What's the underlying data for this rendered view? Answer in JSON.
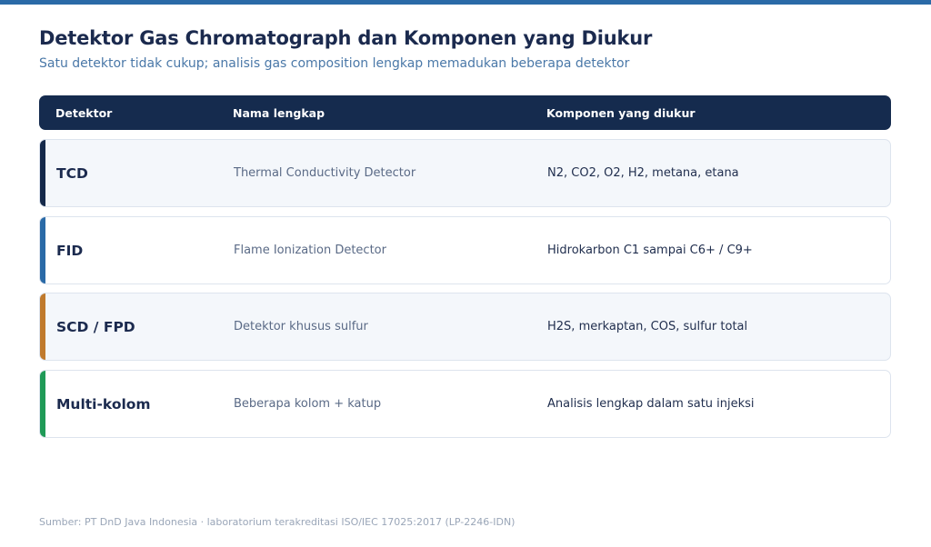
{
  "title": "Detektor Gas Chromatograph dan Komponen yang Diukur",
  "subtitle": "Satu detektor tidak cukup; analisis gas composition lengkap memadukan beberapa detektor",
  "colors": {
    "top_bar": "#2a6aa7",
    "header_bg": "#152b4e"
  },
  "table": {
    "headers": [
      "Detektor",
      "Nama lengkap",
      "Komponen yang diukur"
    ],
    "rows": [
      {
        "detector": "TCD",
        "full_name": "Thermal Conductivity Detector",
        "components": "N2, CO2, O2, H2, metana, etana",
        "accent": "#15294a"
      },
      {
        "detector": "FID",
        "full_name": "Flame Ionization Detector",
        "components": "Hidrokarbon C1 sampai C6+ / C9+",
        "accent": "#2a6aa7"
      },
      {
        "detector": "SCD / FPD",
        "full_name": "Detektor khusus sulfur",
        "components": "H2S, merkaptan, COS, sulfur total",
        "accent": "#c07a2c"
      },
      {
        "detector": "Multi-kolom",
        "full_name": "Beberapa kolom + katup",
        "components": "Analisis lengkap dalam satu injeksi",
        "accent": "#1f9a57"
      }
    ]
  },
  "footer": "Sumber: PT DnD Java Indonesia · laboratorium terakreditasi ISO/IEC 17025:2017 (LP-2246-IDN)"
}
